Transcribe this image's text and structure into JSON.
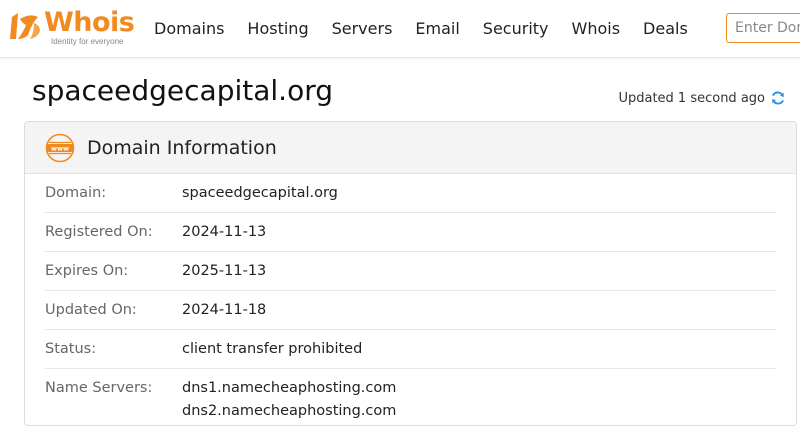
{
  "brand": {
    "name": "Whois",
    "tagline": "Identity for everyone",
    "accent_color": "#f28a1f"
  },
  "nav": {
    "items": [
      "Domains",
      "Hosting",
      "Servers",
      "Email",
      "Security",
      "Whois",
      "Deals"
    ]
  },
  "search": {
    "placeholder": "Enter Domain"
  },
  "page": {
    "domain": "spaceedgecapital.org",
    "updated_text": "Updated 1 second ago"
  },
  "card": {
    "icon": "www-icon",
    "title": "Domain Information",
    "rows": [
      {
        "label": "Domain:",
        "value": "spaceedgecapital.org"
      },
      {
        "label": "Registered On:",
        "value": "2024-11-13"
      },
      {
        "label": "Expires On:",
        "value": "2025-11-13"
      },
      {
        "label": "Updated On:",
        "value": "2024-11-18"
      },
      {
        "label": "Status:",
        "value": "client transfer prohibited"
      }
    ],
    "name_servers": {
      "label": "Name Servers:",
      "values": [
        "dns1.namecheaphosting.com",
        "dns2.namecheaphosting.com"
      ]
    }
  }
}
